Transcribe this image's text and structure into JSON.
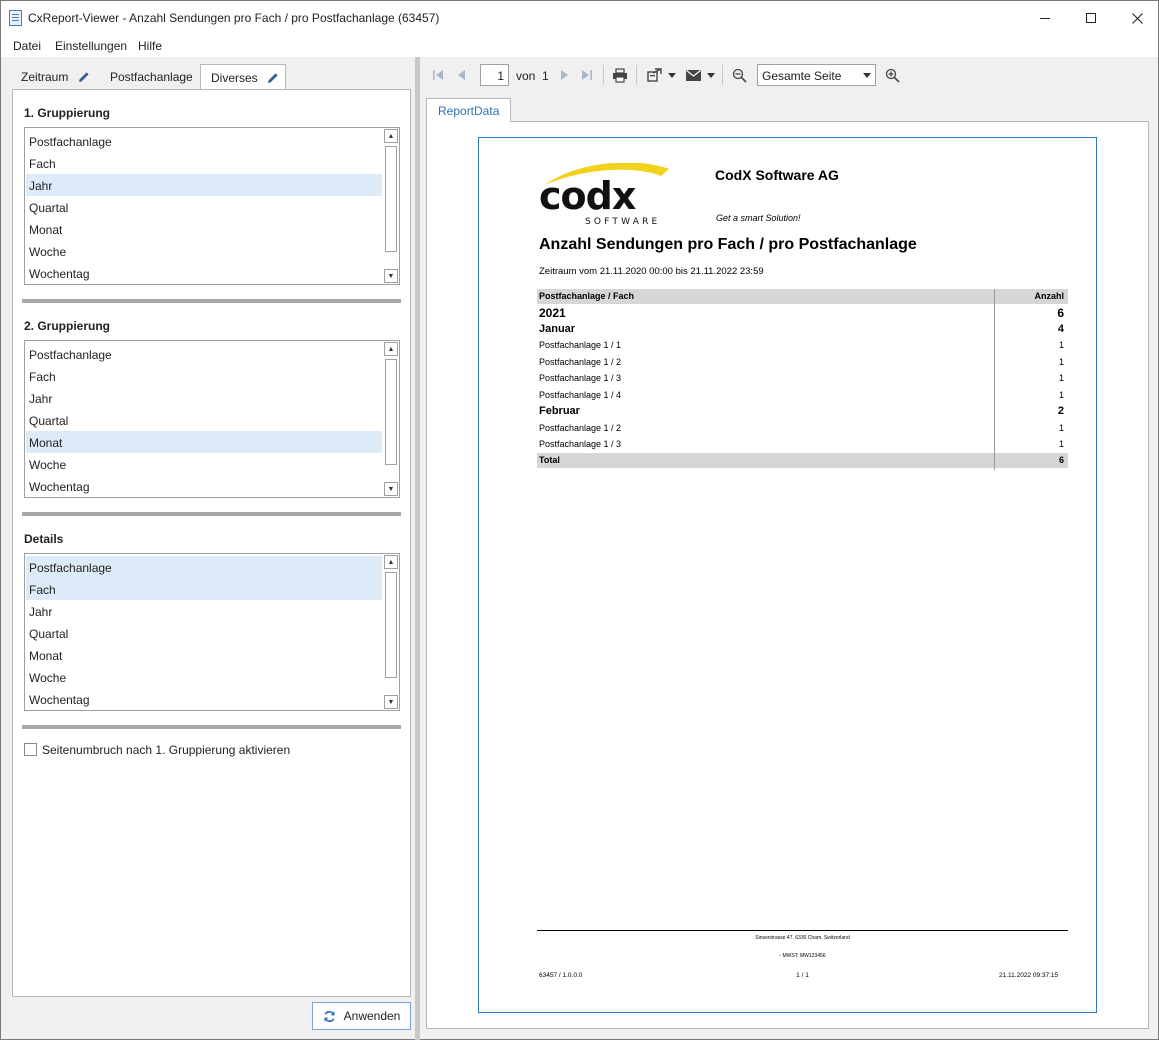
{
  "window": {
    "title": "CxReport-Viewer - Anzahl Sendungen pro Fach / pro Postfachanlage (63457)"
  },
  "menu": {
    "file": "Datei",
    "settings": "Einstellungen",
    "help": "Hilfe"
  },
  "tabs": [
    {
      "label": "Zeitraum",
      "has_edit_icon": true
    },
    {
      "label": "Postfachanlage",
      "has_edit_icon": false
    },
    {
      "label": "Diverses",
      "has_edit_icon": true,
      "active": true
    }
  ],
  "group1": {
    "title": "1. Gruppierung",
    "items": [
      "Postfachanlage",
      "Fach",
      "Jahr",
      "Quartal",
      "Monat",
      "Woche",
      "Wochentag"
    ],
    "selected": [
      "Jahr"
    ]
  },
  "group2": {
    "title": "2. Gruppierung",
    "items": [
      "Postfachanlage",
      "Fach",
      "Jahr",
      "Quartal",
      "Monat",
      "Woche",
      "Wochentag"
    ],
    "selected": [
      "Monat"
    ]
  },
  "details": {
    "title": "Details",
    "items": [
      "Postfachanlage",
      "Fach",
      "Jahr",
      "Quartal",
      "Monat",
      "Woche",
      "Wochentag"
    ],
    "selected": [
      "Postfachanlage",
      "Fach"
    ]
  },
  "pagebreak": {
    "label": "Seitenumbruch nach 1. Gruppierung aktivieren",
    "checked": false
  },
  "apply_button": {
    "label": "Anwenden"
  },
  "toolbar": {
    "current_page": "1",
    "of_label": "von",
    "total_pages": "1",
    "zoom_value": "Gesamte Seite"
  },
  "report_tab": {
    "label": "ReportData"
  },
  "report": {
    "logo_text": "codx",
    "logo_subtext": "SOFTWARE",
    "company": "CodX Software AG",
    "slogan": "Get a smart Solution!",
    "title": "Anzahl Sendungen pro Fach / pro Postfachanlage",
    "period": "Zeitraum vom 21.11.2020 00:00 bis 21.11.2022 23:59",
    "table": {
      "header": {
        "label": "Postfachanlage / Fach",
        "count": "Anzahl"
      },
      "rows": [
        {
          "level": 1,
          "label": "2021",
          "count": "6"
        },
        {
          "level": 2,
          "label": "Januar",
          "count": "4"
        },
        {
          "level": 3,
          "label": "Postfachanlage 1 / 1",
          "count": "1"
        },
        {
          "level": 3,
          "label": "Postfachanlage 1 / 2",
          "count": "1"
        },
        {
          "level": 3,
          "label": "Postfachanlage 1 / 3",
          "count": "1"
        },
        {
          "level": 3,
          "label": "Postfachanlage 1 / 4",
          "count": "1"
        },
        {
          "level": 2,
          "label": "Februar",
          "count": "2"
        },
        {
          "level": 3,
          "label": "Postfachanlage 1 / 2",
          "count": "1"
        },
        {
          "level": 3,
          "label": "Postfachanlage 1 / 3",
          "count": "1"
        }
      ],
      "total": {
        "label": "Total",
        "count": "6"
      }
    },
    "footer": {
      "address": "Sinserstrasse 47, 6330 Cham, Switzerland",
      "vat": "- MWST: MW123456",
      "version": "63457 / 1.0.0.0",
      "page": "1 / 1",
      "timestamp": "21.11.2022 09:37:15"
    }
  },
  "colors": {
    "accent": "#2a72b5",
    "selection": "#ddeaf7",
    "page_border": "#2a7bc4",
    "logo_yellow": "#f2d21a"
  }
}
